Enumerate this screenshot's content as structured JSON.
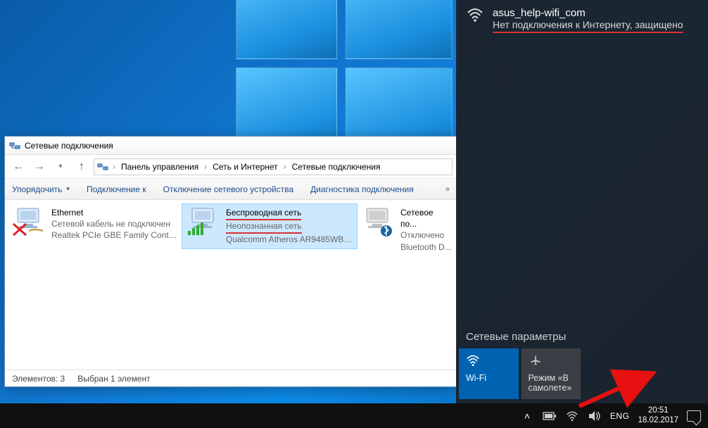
{
  "window": {
    "title": "Сетевые подключения",
    "breadcrumb": [
      "Панель управления",
      "Сеть и Интернет",
      "Сетевые подключения"
    ],
    "toolbar": {
      "organize": "Упорядочить",
      "connect_to": "Подключение к",
      "disable_device": "Отключение сетевого устройства",
      "diagnostics": "Диагностика подключения"
    },
    "connections": [
      {
        "name": "Ethernet",
        "status": "Сетевой кабель не подключен",
        "detail": "Realtek PCIe GBE Family Controller"
      },
      {
        "name": "Беспроводная сеть",
        "status": "Неопознанная сеть",
        "detail": "Qualcomm Atheros AR9485WB-E..."
      },
      {
        "name": "Сетевое по...",
        "status": "Отключено",
        "detail": "Bluetooth D..."
      }
    ],
    "statusbar": {
      "elements": "Элементов: 3",
      "selected": "Выбран 1 элемент"
    }
  },
  "flyout": {
    "network_name": "asus_help-wifi_com",
    "network_sub": "Нет подключения к Интернету, защищено",
    "settings_heading": "Сетевые параметры",
    "tiles": {
      "wifi": "Wi-Fi",
      "airplane_line1": "Режим «В",
      "airplane_line2": "самолете»"
    }
  },
  "taskbar": {
    "lang": "ENG",
    "time": "20:51",
    "date": "18.02.2017"
  },
  "watermark": "help-wifi.com"
}
